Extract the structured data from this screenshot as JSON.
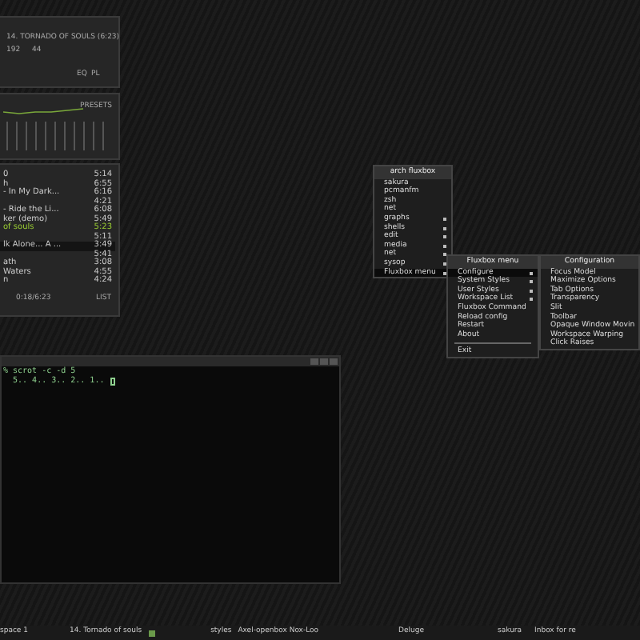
{
  "player": {
    "song_title": "14. TORNADO OF SOULS (6:23)",
    "bitrate": "192",
    "samplerate": "44",
    "eq_button": "EQ",
    "pl_button": "PL",
    "presets_label": "PRESETS"
  },
  "playlist": {
    "rows": [
      {
        "title": "0",
        "time": "5:14",
        "current": false,
        "selected": false
      },
      {
        "title": "h",
        "time": "6:55",
        "current": false,
        "selected": false
      },
      {
        "title": "- In My Dark...",
        "time": "6:16",
        "current": false,
        "selected": false
      },
      {
        "time": "4:21",
        "current": false,
        "selected": false
      },
      {
        "title": "- Ride the Li...",
        "time": "6:08",
        "current": false,
        "selected": false
      },
      {
        "title": "ker (demo)",
        "time": "5:49",
        "current": false,
        "selected": false
      },
      {
        "title": "of souls",
        "time": "5:23",
        "current": true,
        "selected": false
      },
      {
        "time": "5:11",
        "current": false,
        "selected": false
      },
      {
        "title": "lk Alone... A ...",
        "time": "3:49",
        "current": false,
        "selected": true
      },
      {
        "time": "5:41",
        "current": false,
        "selected": false
      },
      {
        "title": "ath",
        "time": "3:08",
        "current": false,
        "selected": false
      },
      {
        "title": "Waters",
        "time": "4:55",
        "current": false,
        "selected": false
      },
      {
        "title": "n",
        "time": "4:24",
        "current": false,
        "selected": false
      }
    ],
    "elapsed": "0:18/6:23",
    "list_button": "LIST"
  },
  "menus": [
    {
      "title": "arch fluxbox",
      "items": [
        {
          "label": "sakura",
          "submenu": false,
          "selected": false
        },
        {
          "label": "pcmanfm",
          "submenu": false,
          "selected": false
        },
        {
          "label": "zsh",
          "submenu": false,
          "selected": false
        },
        {
          "label": "net",
          "submenu": false,
          "selected": false
        },
        {
          "label": "graphs",
          "submenu": true,
          "selected": false
        },
        {
          "label": "shells",
          "submenu": true,
          "selected": false
        },
        {
          "label": "edit",
          "submenu": true,
          "selected": false
        },
        {
          "label": "media",
          "submenu": true,
          "selected": false
        },
        {
          "label": "net",
          "submenu": true,
          "selected": false
        },
        {
          "label": "sysop",
          "submenu": true,
          "selected": false
        },
        {
          "label": "Fluxbox menu",
          "submenu": true,
          "selected": true
        }
      ]
    },
    {
      "title": "Fluxbox menu",
      "items": [
        {
          "label": "Configure",
          "submenu": true,
          "selected": true
        },
        {
          "label": "System Styles",
          "submenu": true,
          "selected": false
        },
        {
          "label": "User Styles",
          "submenu": true,
          "selected": false
        },
        {
          "label": "Workspace List",
          "submenu": true,
          "selected": false
        },
        {
          "label": "Fluxbox Command",
          "submenu": false,
          "selected": false
        },
        {
          "label": "Reload config",
          "submenu": false,
          "selected": false
        },
        {
          "label": "Restart",
          "submenu": false,
          "selected": false
        },
        {
          "label": "About",
          "submenu": false,
          "selected": false
        },
        {
          "label": "Exit",
          "submenu": false,
          "selected": false,
          "separator_before": true
        }
      ]
    },
    {
      "title": "Configuration",
      "items": [
        {
          "label": "Focus Model",
          "submenu": false,
          "selected": false
        },
        {
          "label": "Maximize Options",
          "submenu": false,
          "selected": false
        },
        {
          "label": "Tab Options",
          "submenu": false,
          "selected": false
        },
        {
          "label": "Transparency",
          "submenu": false,
          "selected": false
        },
        {
          "label": "Slit",
          "submenu": false,
          "selected": false
        },
        {
          "label": "Toolbar",
          "submenu": false,
          "selected": false
        },
        {
          "label": "Opaque Window Movin",
          "submenu": false,
          "selected": false
        },
        {
          "label": "Workspace Warping",
          "submenu": false,
          "selected": false
        },
        {
          "label": "Click Raises",
          "submenu": false,
          "selected": false
        }
      ]
    }
  ],
  "terminal": {
    "lines": [
      "% scrot -c -d 5",
      "  5.. 4.. 3.. 2.. 1.."
    ]
  },
  "taskbar": {
    "workspace": "space 1",
    "now_playing": "14. Tornado of souls",
    "tasks": [
      {
        "label": "styles",
        "focused": false
      },
      {
        "label": "Axel-openbox Nox-Loo",
        "focused": false
      },
      {
        "label": "Deluge",
        "focused": false
      },
      {
        "label": "sakura",
        "focused": false
      },
      {
        "label": "Inbox for re",
        "focused": false
      }
    ]
  }
}
